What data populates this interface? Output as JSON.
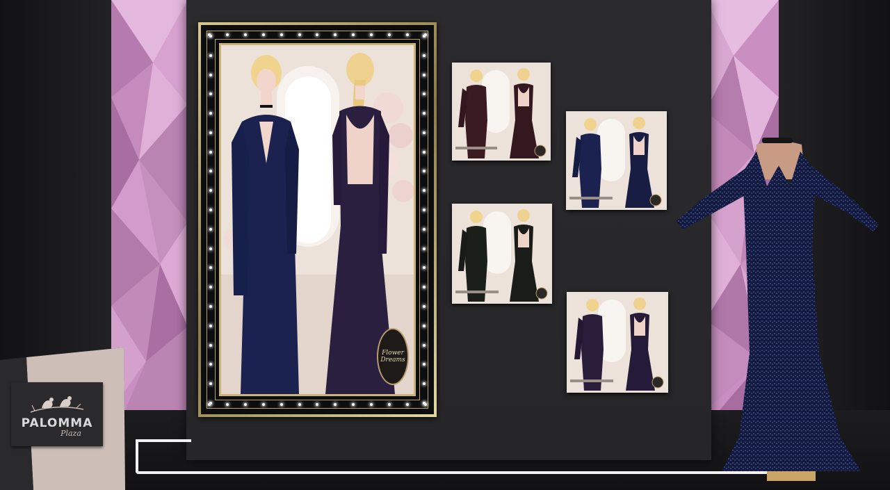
{
  "scene": {
    "colors": {
      "wall": "#2b2b2d",
      "pink": "#c98fc2",
      "gold": "#c9b57c",
      "gown_navy": "#1a2044",
      "gown_wine": "#3a1b22",
      "gown_black": "#1b1f1a",
      "gown_purple": "#2a1d3a"
    }
  },
  "logo": {
    "name": "PALOMMA",
    "script": "Plaza",
    "icon": "birds-on-branch-icon"
  },
  "main_poster": {
    "brand_title": "Flower Dreams",
    "gown_color": "navy-and-purple"
  },
  "small_posters": [
    {
      "gown_color": "wine"
    },
    {
      "gown_color": "navy"
    },
    {
      "gown_color": "black"
    },
    {
      "gown_color": "purple"
    }
  ],
  "mannequin": {
    "gown_color": "navy-sequin"
  }
}
